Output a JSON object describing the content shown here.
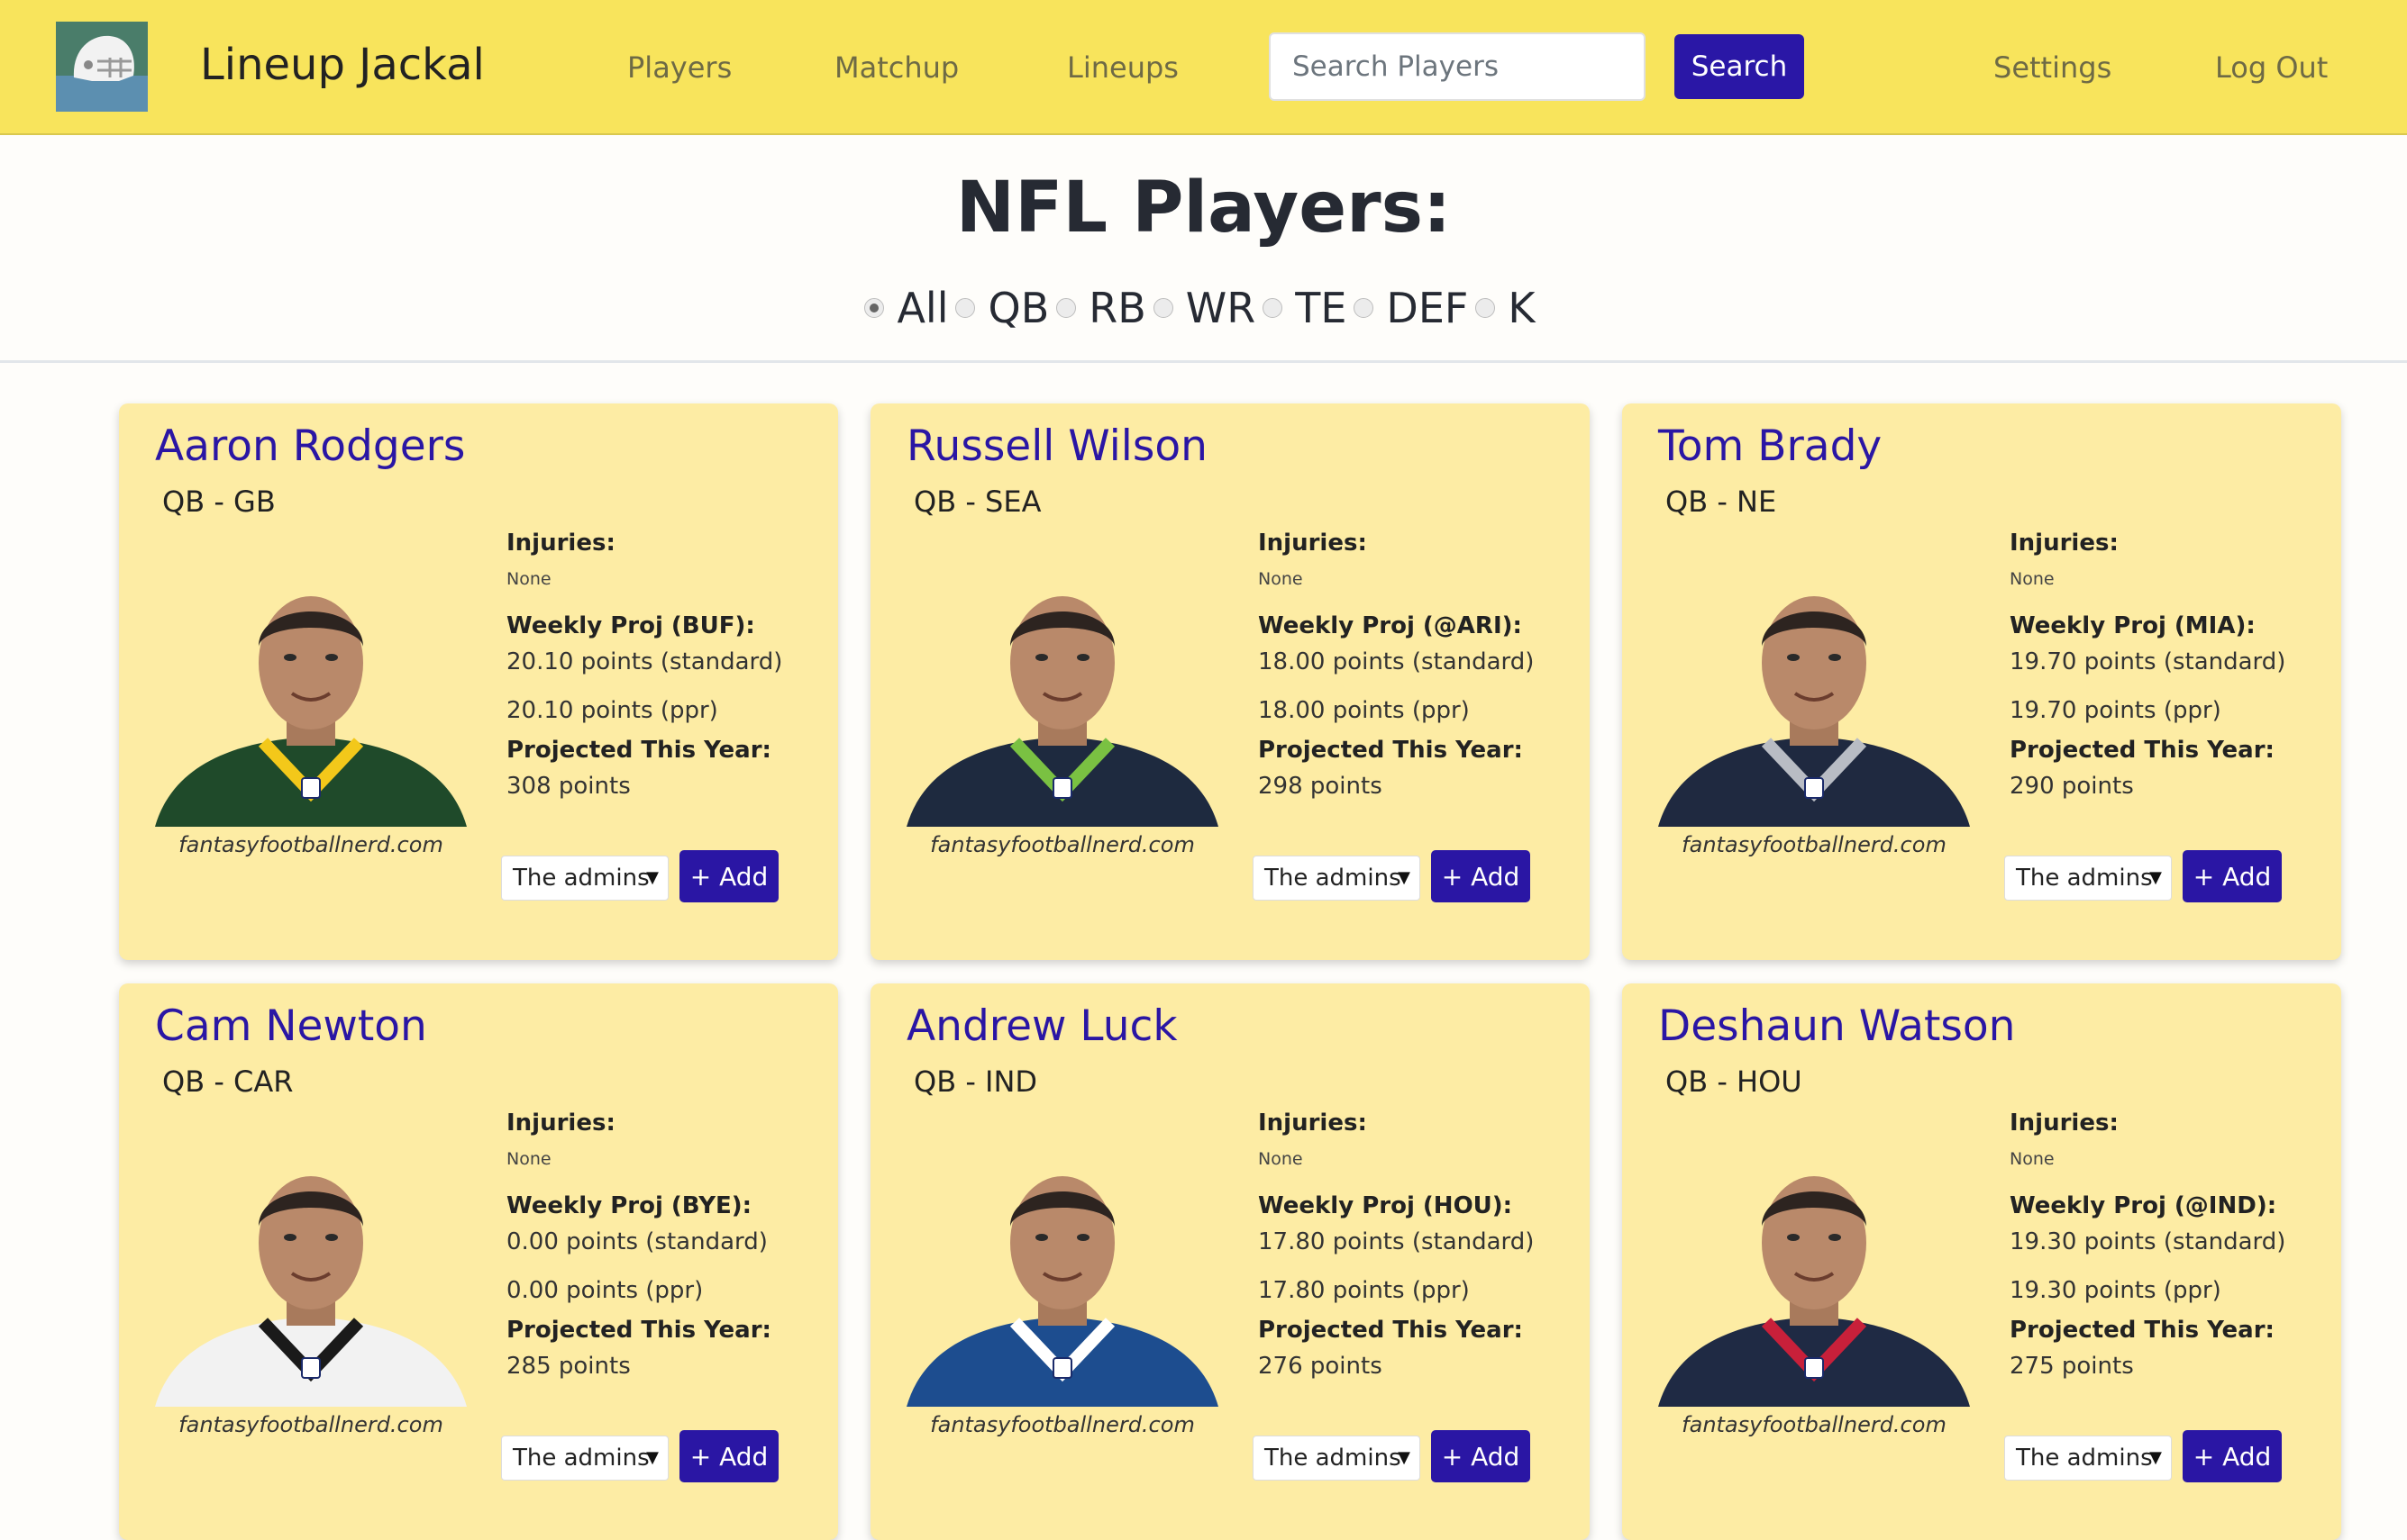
{
  "nav": {
    "brand": "Lineup Jackal",
    "links": [
      "Players",
      "Matchup",
      "Lineups"
    ],
    "search_placeholder": "Search Players",
    "search_button": "Search",
    "settings": "Settings",
    "logout": "Log Out"
  },
  "header": {
    "title": "NFL Players:",
    "filters": [
      "All",
      "QB",
      "RB",
      "WR",
      "TE",
      "DEF",
      "K"
    ],
    "selected_filter": "All"
  },
  "cards": [
    {
      "name": "Aaron Rodgers",
      "position": "QB - GB",
      "injuries_label": "Injuries:",
      "injuries": "None",
      "weekly_label": "Weekly Proj (BUF):",
      "standard": "20.10 points (standard)",
      "ppr": "20.10 points (ppr)",
      "year_label": "Projected This Year:",
      "year": "308 points",
      "credit": "fantasyfootballnerd.com",
      "team_select": "The admins",
      "add_button": "+ Add",
      "jersey": "#1f4a2a",
      "trim": "#f3c81a"
    },
    {
      "name": "Russell Wilson",
      "position": "QB - SEA",
      "injuries_label": "Injuries:",
      "injuries": "None",
      "weekly_label": "Weekly Proj (@ARI):",
      "standard": "18.00 points (standard)",
      "ppr": "18.00 points (ppr)",
      "year_label": "Projected This Year:",
      "year": "298 points",
      "credit": "fantasyfootballnerd.com",
      "team_select": "The admins",
      "add_button": "+ Add",
      "jersey": "#1e2a3f",
      "trim": "#7ac142"
    },
    {
      "name": "Tom Brady",
      "position": "QB - NE",
      "injuries_label": "Injuries:",
      "injuries": "None",
      "weekly_label": "Weekly Proj (MIA):",
      "standard": "19.70 points (standard)",
      "ppr": "19.70 points (ppr)",
      "year_label": "Projected This Year:",
      "year": "290 points",
      "credit": "fantasyfootballnerd.com",
      "team_select": "The admins",
      "add_button": "+ Add",
      "jersey": "#1f2940",
      "trim": "#b8bcc4"
    },
    {
      "name": "Cam Newton",
      "position": "QB - CAR",
      "injuries_label": "Injuries:",
      "injuries": "None",
      "weekly_label": "Weekly Proj (BYE):",
      "standard": "0.00 points (standard)",
      "ppr": "0.00 points (ppr)",
      "year_label": "Projected This Year:",
      "year": "285 points",
      "credit": "fantasyfootballnerd.com",
      "team_select": "The admins",
      "add_button": "+ Add",
      "jersey": "#f2f2f2",
      "trim": "#1a1a1a"
    },
    {
      "name": "Andrew Luck",
      "position": "QB - IND",
      "injuries_label": "Injuries:",
      "injuries": "None",
      "weekly_label": "Weekly Proj (HOU):",
      "standard": "17.80 points (standard)",
      "ppr": "17.80 points (ppr)",
      "year_label": "Projected This Year:",
      "year": "276 points",
      "credit": "fantasyfootballnerd.com",
      "team_select": "The admins",
      "add_button": "+ Add",
      "jersey": "#1d4d8f",
      "trim": "#ffffff"
    },
    {
      "name": "Deshaun Watson",
      "position": "QB - HOU",
      "injuries_label": "Injuries:",
      "injuries": "None",
      "weekly_label": "Weekly Proj (@IND):",
      "standard": "19.30 points (standard)",
      "ppr": "19.30 points (ppr)",
      "year_label": "Projected This Year:",
      "year": "275 points",
      "credit": "fantasyfootballnerd.com",
      "team_select": "The admins",
      "add_button": "+ Add",
      "jersey": "#1f2a44",
      "trim": "#c8203a"
    }
  ]
}
